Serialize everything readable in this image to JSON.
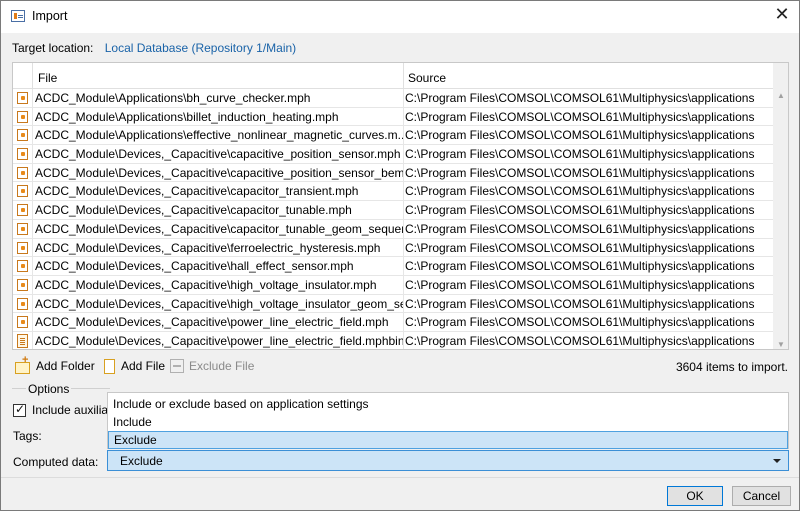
{
  "window": {
    "title": "Import",
    "close_glyph": "✕"
  },
  "target": {
    "label": "Target location:",
    "value": "Local Database (Repository 1/Main)"
  },
  "table": {
    "columns": [
      "File",
      "Source"
    ],
    "rows": [
      {
        "icon": "mph-file-icon",
        "file": "ACDC_Module\\Applications\\bh_curve_checker.mph",
        "source": "C:\\Program Files\\COMSOL\\COMSOL61\\Multiphysics\\applications"
      },
      {
        "icon": "mph-file-icon",
        "file": "ACDC_Module\\Applications\\billet_induction_heating.mph",
        "source": "C:\\Program Files\\COMSOL\\COMSOL61\\Multiphysics\\applications"
      },
      {
        "icon": "mph-file-icon",
        "file": "ACDC_Module\\Applications\\effective_nonlinear_magnetic_curves.m...",
        "source": "C:\\Program Files\\COMSOL\\COMSOL61\\Multiphysics\\applications"
      },
      {
        "icon": "mph-file-icon",
        "file": "ACDC_Module\\Devices,_Capacitive\\capacitive_position_sensor.mph",
        "source": "C:\\Program Files\\COMSOL\\COMSOL61\\Multiphysics\\applications"
      },
      {
        "icon": "mph-file-icon",
        "file": "ACDC_Module\\Devices,_Capacitive\\capacitive_position_sensor_bem....",
        "source": "C:\\Program Files\\COMSOL\\COMSOL61\\Multiphysics\\applications"
      },
      {
        "icon": "mph-file-icon",
        "file": "ACDC_Module\\Devices,_Capacitive\\capacitor_transient.mph",
        "source": "C:\\Program Files\\COMSOL\\COMSOL61\\Multiphysics\\applications"
      },
      {
        "icon": "mph-file-icon",
        "file": "ACDC_Module\\Devices,_Capacitive\\capacitor_tunable.mph",
        "source": "C:\\Program Files\\COMSOL\\COMSOL61\\Multiphysics\\applications"
      },
      {
        "icon": "mph-file-icon",
        "file": "ACDC_Module\\Devices,_Capacitive\\capacitor_tunable_geom_sequen...",
        "source": "C:\\Program Files\\COMSOL\\COMSOL61\\Multiphysics\\applications"
      },
      {
        "icon": "mph-file-icon",
        "file": "ACDC_Module\\Devices,_Capacitive\\ferroelectric_hysteresis.mph",
        "source": "C:\\Program Files\\COMSOL\\COMSOL61\\Multiphysics\\applications"
      },
      {
        "icon": "mph-file-icon",
        "file": "ACDC_Module\\Devices,_Capacitive\\hall_effect_sensor.mph",
        "source": "C:\\Program Files\\COMSOL\\COMSOL61\\Multiphysics\\applications"
      },
      {
        "icon": "mph-file-icon",
        "file": "ACDC_Module\\Devices,_Capacitive\\high_voltage_insulator.mph",
        "source": "C:\\Program Files\\COMSOL\\COMSOL61\\Multiphysics\\applications"
      },
      {
        "icon": "mph-file-icon",
        "file": "ACDC_Module\\Devices,_Capacitive\\high_voltage_insulator_geom_se...",
        "source": "C:\\Program Files\\COMSOL\\COMSOL61\\Multiphysics\\applications"
      },
      {
        "icon": "mph-file-icon",
        "file": "ACDC_Module\\Devices,_Capacitive\\power_line_electric_field.mph",
        "source": "C:\\Program Files\\COMSOL\\COMSOL61\\Multiphysics\\applications"
      },
      {
        "icon": "mphbin-file-icon",
        "file": "ACDC_Module\\Devices,_Capacitive\\power_line_electric_field.mphbin",
        "source": "C:\\Program Files\\COMSOL\\COMSOL61\\Multiphysics\\applications"
      }
    ]
  },
  "toolbar": {
    "add_folder": "Add Folder",
    "add_file": "Add File",
    "exclude_file": "Exclude File",
    "items_count": "3604 items to import."
  },
  "options": {
    "group_label": "Options",
    "include_label": "Include auxilia",
    "include_checked": true,
    "tags_label": "Tags:",
    "computed_label": "Computed data:",
    "dropdown_options": [
      "Include or exclude based on application settings",
      "Include",
      "Exclude"
    ],
    "selected": "Exclude"
  },
  "buttons": {
    "ok": "OK",
    "cancel": "Cancel"
  },
  "colors": {
    "link_blue": "#1a63a8",
    "selection_bg": "#cce4f7",
    "selection_border": "#3b8fd6",
    "icon_orange": "#e88a1a"
  }
}
